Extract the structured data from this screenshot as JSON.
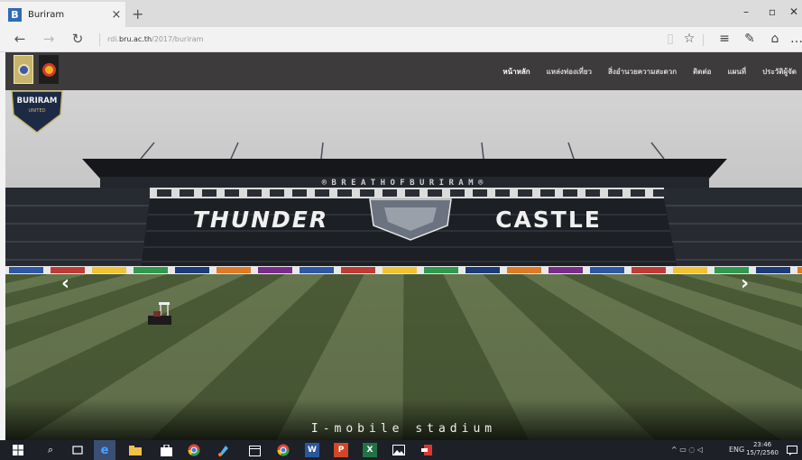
{
  "browser": {
    "tab_title": "Buriram",
    "tab_favicon_letter": "B",
    "close_tab_glyph": "×",
    "new_tab_glyph": "+",
    "window_controls": {
      "minimize": "–",
      "maximize": "▫",
      "close": "✕"
    },
    "url_prefix": "rdi.",
    "url_domain": "bru.ac.th",
    "url_path": "/2017/buriram",
    "icons": [
      "back-icon",
      "forward-icon",
      "refresh-icon",
      "reading-view-icon",
      "favorite-star-icon",
      "hub-icon",
      "web-note-icon",
      "share-icon",
      "more-icon"
    ]
  },
  "site": {
    "nav_items": [
      {
        "label": "หน้าหลัก",
        "active": true
      },
      {
        "label": "แหล่งท่องเที่ยว",
        "active": false
      },
      {
        "label": "สิ่งอำนวยความสะดวก",
        "active": false
      },
      {
        "label": "ติดต่อ",
        "active": false
      },
      {
        "label": "แผนที่",
        "active": false
      },
      {
        "label": "ประวัติผู้จัด",
        "active": false
      }
    ],
    "crest_text": "BURIRAM",
    "crest_subtext": "UNITED",
    "stadium_banner": "®  B R E A T H   O F   B U R I R A M  ®",
    "stadium_left_text": "THUNDER",
    "stadium_right_text": "CASTLE",
    "slider_prev_glyph": "‹",
    "slider_next_glyph": "›",
    "slide_caption": "I-mobile stadium",
    "accent_colors": {
      "nav_bg": "#3d3b3c",
      "pitch_light": "#6a7a52",
      "pitch_dark": "#3e4c2e",
      "stand": "#1c1f24"
    }
  },
  "taskbar": {
    "apps": [
      "start-icon",
      "search-icon",
      "task-view-icon",
      "edge-icon",
      "file-explorer-icon",
      "store-icon",
      "chrome-icon",
      "paint-icon",
      "calendar-icon",
      "chrome-icon",
      "word-icon",
      "powerpoint-icon",
      "excel-icon",
      "photos-icon",
      "acrobat-icon"
    ],
    "tray_symbols": "^ ▭ ◌ ◁",
    "language": "ENG",
    "time": "23:46",
    "date": "15/7/2560"
  }
}
